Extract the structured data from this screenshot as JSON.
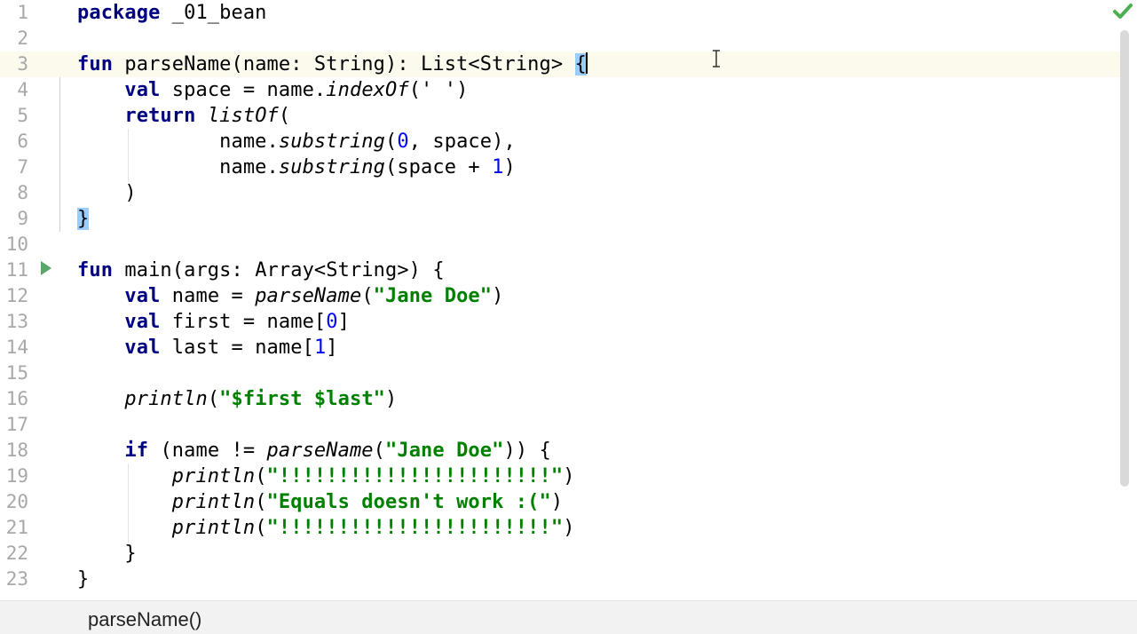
{
  "editor": {
    "language": "Kotlin",
    "current_line": 3,
    "lines": [
      {
        "n": "1",
        "tokens": [
          [
            "kw",
            "package"
          ],
          [
            "p",
            " _01_bean"
          ]
        ]
      },
      {
        "n": "2",
        "tokens": []
      },
      {
        "n": "3",
        "tokens": [
          [
            "kw",
            "fun"
          ],
          [
            "p",
            " parseName(name: String): List<String> "
          ],
          [
            "match",
            "{"
          ],
          [
            "caret",
            ""
          ]
        ]
      },
      {
        "n": "4",
        "tokens": [
          [
            "p",
            "    "
          ],
          [
            "kw",
            "val"
          ],
          [
            "p",
            " space = name."
          ],
          [
            "fn",
            "indexOf"
          ],
          [
            "p",
            "(' ')"
          ]
        ]
      },
      {
        "n": "5",
        "tokens": [
          [
            "p",
            "    "
          ],
          [
            "kw",
            "return"
          ],
          [
            "p",
            " "
          ],
          [
            "fn",
            "listOf"
          ],
          [
            "p",
            "("
          ]
        ]
      },
      {
        "n": "6",
        "tokens": [
          [
            "p",
            "            name."
          ],
          [
            "fn",
            "substring"
          ],
          [
            "p",
            "("
          ],
          [
            "num",
            "0"
          ],
          [
            "p",
            ", space),"
          ]
        ]
      },
      {
        "n": "7",
        "tokens": [
          [
            "p",
            "            name."
          ],
          [
            "fn",
            "substring"
          ],
          [
            "p",
            "(space + "
          ],
          [
            "num",
            "1"
          ],
          [
            "p",
            ")"
          ]
        ]
      },
      {
        "n": "8",
        "tokens": [
          [
            "p",
            "    )"
          ]
        ]
      },
      {
        "n": "9",
        "tokens": [
          [
            "match",
            "}"
          ]
        ]
      },
      {
        "n": "10",
        "tokens": []
      },
      {
        "n": "11",
        "tokens": [
          [
            "kw",
            "fun"
          ],
          [
            "p",
            " main(args: Array<String>) {"
          ]
        ]
      },
      {
        "n": "12",
        "tokens": [
          [
            "p",
            "    "
          ],
          [
            "kw",
            "val"
          ],
          [
            "p",
            " name = "
          ],
          [
            "fn",
            "parseName"
          ],
          [
            "p",
            "("
          ],
          [
            "str",
            "\"Jane Doe\""
          ],
          [
            "p",
            ")"
          ]
        ]
      },
      {
        "n": "13",
        "tokens": [
          [
            "p",
            "    "
          ],
          [
            "kw",
            "val"
          ],
          [
            "p",
            " first = name["
          ],
          [
            "num",
            "0"
          ],
          [
            "p",
            "]"
          ]
        ]
      },
      {
        "n": "14",
        "tokens": [
          [
            "p",
            "    "
          ],
          [
            "kw",
            "val"
          ],
          [
            "p",
            " last = name["
          ],
          [
            "num",
            "1"
          ],
          [
            "p",
            "]"
          ]
        ]
      },
      {
        "n": "15",
        "tokens": []
      },
      {
        "n": "16",
        "tokens": [
          [
            "p",
            "    "
          ],
          [
            "fn",
            "println"
          ],
          [
            "p",
            "("
          ],
          [
            "str",
            "\"$first $last\""
          ],
          [
            "p",
            ")"
          ]
        ]
      },
      {
        "n": "17",
        "tokens": []
      },
      {
        "n": "18",
        "tokens": [
          [
            "p",
            "    "
          ],
          [
            "kw",
            "if"
          ],
          [
            "p",
            " (name != "
          ],
          [
            "fn",
            "parseName"
          ],
          [
            "p",
            "("
          ],
          [
            "str",
            "\"Jane Doe\""
          ],
          [
            "p",
            ")) {"
          ]
        ]
      },
      {
        "n": "19",
        "tokens": [
          [
            "p",
            "        "
          ],
          [
            "fn",
            "println"
          ],
          [
            "p",
            "("
          ],
          [
            "str",
            "\"!!!!!!!!!!!!!!!!!!!!!!!\""
          ],
          [
            "p",
            ")"
          ]
        ]
      },
      {
        "n": "20",
        "tokens": [
          [
            "p",
            "        "
          ],
          [
            "fn",
            "println"
          ],
          [
            "p",
            "("
          ],
          [
            "str",
            "\"Equals doesn't work :(\""
          ],
          [
            "p",
            ")"
          ]
        ]
      },
      {
        "n": "21",
        "tokens": [
          [
            "p",
            "        "
          ],
          [
            "fn",
            "println"
          ],
          [
            "p",
            "("
          ],
          [
            "str",
            "\"!!!!!!!!!!!!!!!!!!!!!!!\""
          ],
          [
            "p",
            ")"
          ]
        ]
      },
      {
        "n": "22",
        "tokens": [
          [
            "p",
            "    }"
          ]
        ]
      },
      {
        "n": "23",
        "tokens": [
          [
            "p",
            "}"
          ]
        ]
      }
    ]
  },
  "breadcrumb": {
    "label": "parseName()"
  },
  "colors": {
    "keyword": "#000080",
    "string": "#008000",
    "number": "#0000ff",
    "current_line": "#fcfaed",
    "brace_match": "#99ccff"
  },
  "icons": {
    "run": "run-gutter-icon",
    "inspection_ok": "check-icon"
  }
}
